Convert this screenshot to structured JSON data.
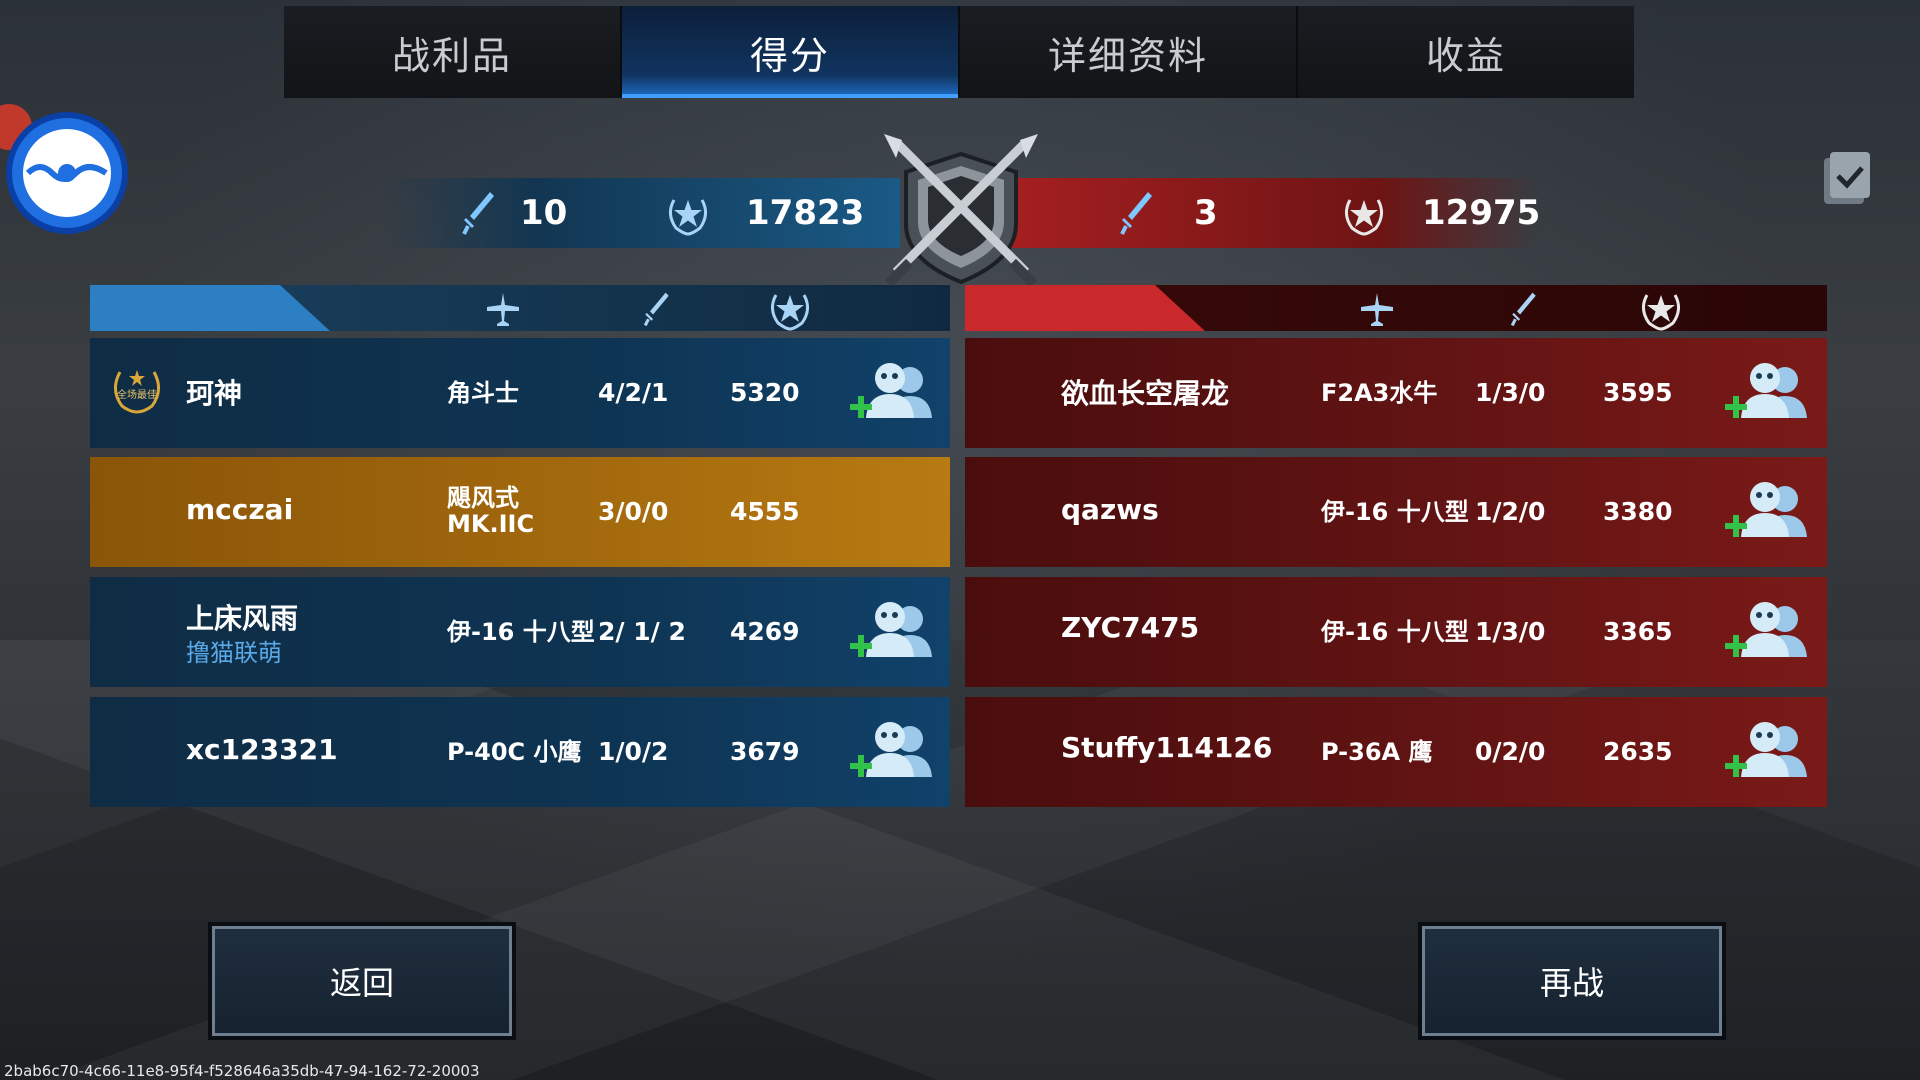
{
  "tabs": [
    {
      "label": "战利品"
    },
    {
      "label": "得分"
    },
    {
      "label": "详细资料"
    },
    {
      "label": "收益"
    }
  ],
  "active_tab": "得分",
  "summary": {
    "blue": {
      "kills": "10",
      "score": "17823"
    },
    "red": {
      "kills": "3",
      "score": "12975"
    }
  },
  "blue_team": [
    {
      "name": "珂神",
      "sub": "",
      "plane": "角斗士",
      "kda": "4/2/1",
      "score": "5320",
      "mvp_label": "全场最佳",
      "add_friend": true
    },
    {
      "name": "mcczai",
      "sub": "",
      "plane": "飓风式\nMK.IIC",
      "kda": "3/0/0",
      "score": "4555",
      "self": true,
      "add_friend": false
    },
    {
      "name": "上床风雨",
      "sub": "撸猫联萌",
      "plane": "伊-16 十八型",
      "kda": "2/ 1/ 2",
      "score": "4269",
      "add_friend": true
    },
    {
      "name": "xc123321",
      "sub": "",
      "plane": "P-40C 小鹰",
      "kda": "1/0/2",
      "score": "3679",
      "add_friend": true
    }
  ],
  "red_team": [
    {
      "name": "欲血长空屠龙",
      "plane": "F2A3水牛",
      "kda": "1/3/0",
      "score": "3595",
      "add_friend": true
    },
    {
      "name": "qazws",
      "plane": "伊-16 十八型",
      "kda": "1/2/0",
      "score": "3380",
      "add_friend": true
    },
    {
      "name": "ZYC7475",
      "plane": "伊-16 十八型",
      "kda": "1/3/0",
      "score": "3365",
      "add_friend": true
    },
    {
      "name": "Stuffy114126",
      "plane": "P-36A 鹰",
      "kda": "0/2/0",
      "score": "2635",
      "add_friend": true
    }
  ],
  "buttons": {
    "back": "返回",
    "rematch": "再战"
  },
  "footer_id": "2bab6c70-4c66-11e8-95f4-f528646a35db-47-94-162-72-20003",
  "colors": {
    "blue_team": "#2b7fc2",
    "red_team": "#c9292a",
    "self_row": "#a46a0d",
    "tab_active": "#1f6fc9",
    "guild_tag": "#5aa8e6"
  },
  "icons": {
    "header_plane": "plane-icon",
    "header_kills": "sword-icon",
    "header_score": "laurel-star-icon",
    "add_friend": "add-friend-icon",
    "emblem": "crossed-swords-shield-emblem",
    "float": "floating-assistant-icon",
    "clipboard": "clipboard-check-icon"
  }
}
